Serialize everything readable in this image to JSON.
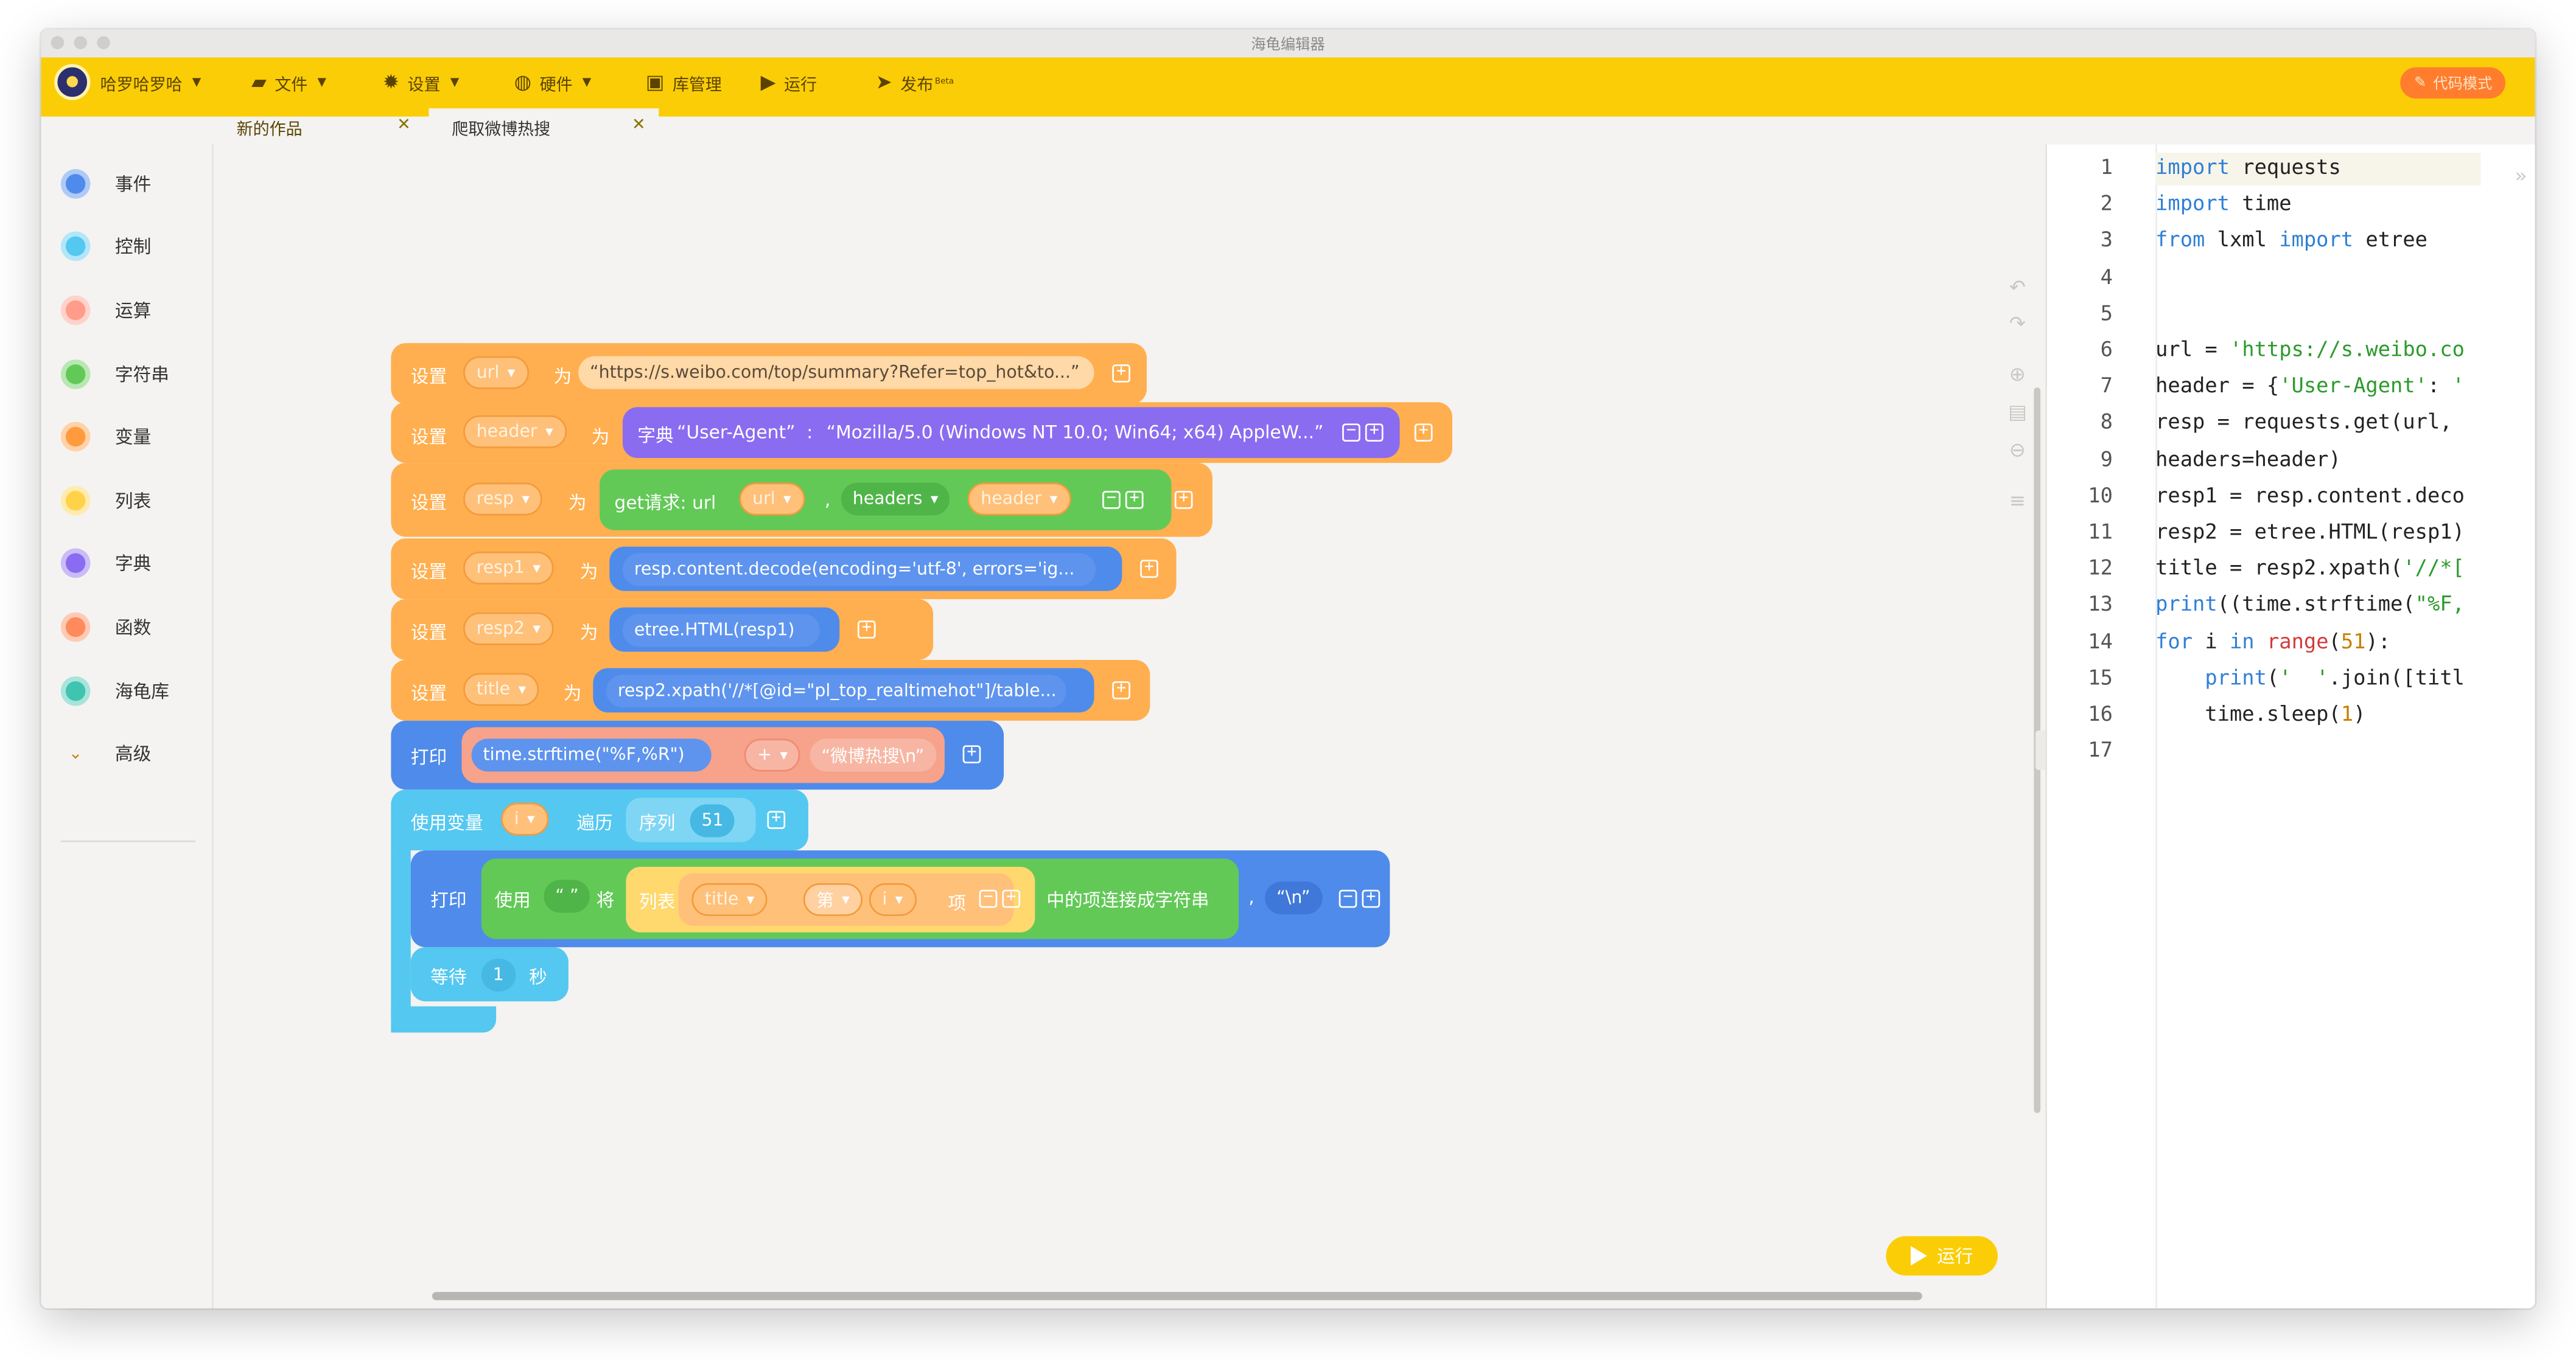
{
  "window": {
    "title": "海龟编辑器"
  },
  "toolbar": {
    "user": "哈罗哈罗哈",
    "file": "文件",
    "settings": "设置",
    "hardware": "硬件",
    "library": "库管理",
    "run": "运行",
    "publish": "发布",
    "publish_badge": "Beta",
    "code_mode": "代码模式"
  },
  "tabs": [
    {
      "label": "新的作品"
    },
    {
      "label": "爬取微博热搜"
    }
  ],
  "sidebar": {
    "items": [
      {
        "label": "事件",
        "color": "#4f8bea"
      },
      {
        "label": "控制",
        "color": "#54c8f0"
      },
      {
        "label": "运算",
        "color": "#ff9c8a"
      },
      {
        "label": "字符串",
        "color": "#62c957"
      },
      {
        "label": "变量",
        "color": "#ff9b3e"
      },
      {
        "label": "列表",
        "color": "#ffd24a"
      },
      {
        "label": "字典",
        "color": "#8a6cf0"
      },
      {
        "label": "函数",
        "color": "#ff8a5c"
      },
      {
        "label": "海龟库",
        "color": "#3fc4b0"
      }
    ],
    "advanced": "高级"
  },
  "blocks": {
    "set": "设置",
    "as": "为",
    "b1": {
      "var": "url",
      "value": "“https://s.weibo.com/top/summary?Refer=top_hot&to...”"
    },
    "b2": {
      "var": "header",
      "dict_label": "字典",
      "key": "“User-Agent”",
      "colon": ":",
      "value": "“Mozilla/5.0 (Windows NT 10.0; Win64; x64) AppleW...”"
    },
    "b3": {
      "var": "resp",
      "call": "get请求: url",
      "arg1": "url",
      "comma": ",",
      "kw": "headers",
      "arg2": "header"
    },
    "b4": {
      "var": "resp1",
      "expr": "resp.content.decode(encoding='utf-8', errors='ig..."
    },
    "b5": {
      "var": "resp2",
      "expr": "etree.HTML(resp1)"
    },
    "b6": {
      "var": "title",
      "expr": "resp2.xpath('//*[@id=\"pl_top_realtimehot\"]/table..."
    },
    "b7": {
      "label": "打印",
      "expr": "time.strftime(\"%F,%R\")",
      "op": "+",
      "str": "“微博热搜\\n”"
    },
    "b8": {
      "label": "使用变量",
      "var": "i",
      "iterate": "遍历",
      "seq": "序列",
      "num": "51"
    },
    "b9": {
      "label": "打印",
      "use": "使用",
      "sep": "“  ”",
      "with": "将",
      "list": "列表",
      "list_var": "title",
      "index_label": "第",
      "index_var": "i",
      "item": "项",
      "join": "中的项连接成字符串",
      "comma": ",",
      "end": "“\\n”"
    },
    "b10": {
      "label": "等待",
      "num": "1",
      "unit": "秒"
    }
  },
  "run_button": "运行",
  "code": {
    "lines": [
      "import requests",
      "import time",
      "from lxml import etree",
      "",
      "",
      "url = 'https://s.weibo.co",
      "header = {'User-Agent': '",
      "resp = requests.get(url,",
      "headers=header)",
      "resp1 = resp.content.deco",
      "resp2 = etree.HTML(resp1)",
      "title = resp2.xpath('//*[",
      "print((time.strftime(\"%F,",
      "for i in range(51):",
      "    print('  '.join([titl",
      "    time.sleep(1)",
      ""
    ],
    "numbers": [
      "1",
      "2",
      "3",
      "4",
      "5",
      "6",
      "7",
      "8",
      "9",
      "10",
      "11",
      "12",
      "13",
      "14",
      "15",
      "16",
      "17"
    ]
  }
}
